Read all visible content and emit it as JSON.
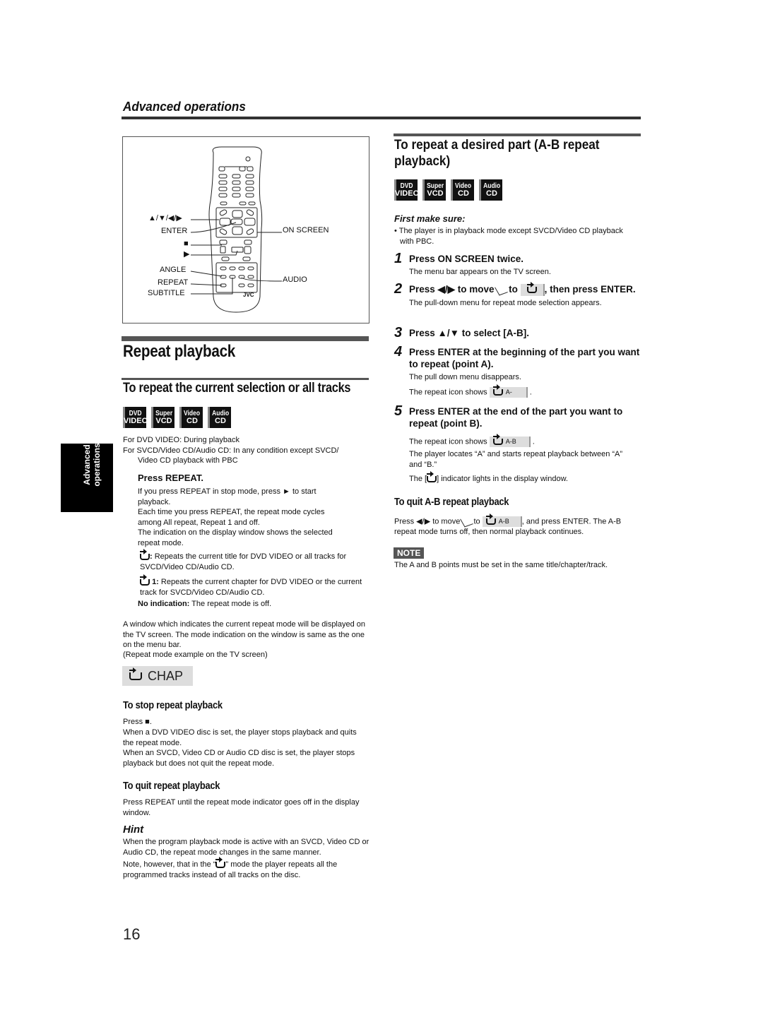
{
  "header": {
    "section_title": "Advanced operations"
  },
  "side_tab": {
    "line1": "Advanced",
    "line2": "operations"
  },
  "remote": {
    "brand": "JVC",
    "labels_left": {
      "arrows": "▲/▼/◀/▶",
      "enter": "ENTER",
      "stop": "■",
      "play": "▶",
      "angle": "ANGLE",
      "repeat": "REPEAT",
      "subtitle": "SUBTITLE"
    },
    "labels_right": {
      "on_screen": "ON SCREEN",
      "audio": "AUDIO"
    }
  },
  "disc_badges": [
    {
      "top": "DVD",
      "bottom": "VIDEO"
    },
    {
      "top": "Super",
      "bottom": "VCD"
    },
    {
      "top": "Video",
      "bottom": "CD"
    },
    {
      "top": "Audio",
      "bottom": "CD"
    }
  ],
  "left": {
    "title": "Repeat playback",
    "subtitle": "To repeat the current selection or all tracks",
    "cond1": "For DVD VIDEO: During playback",
    "cond2": "For SVCD/Video CD/Audio CD: In any condition except SVCD/",
    "cond2b": "Video CD playback with PBC",
    "press_repeat": "Press REPEAT.",
    "p1": "If you press REPEAT in stop mode, press ► to start playback.",
    "p2": "Each time you press REPEAT, the repeat mode cycles among All repeat, Repeat 1 and off.",
    "p3": "The indication on the display window shows the selected repeat mode.",
    "mode_all_suffix": ":",
    "mode_all_desc": " Repeats the current title for DVD VIDEO or all tracks for SVCD/Video CD/Audio CD.",
    "mode_one_suffix": "1:",
    "mode_one_desc": " Repeats the current chapter for DVD VIDEO or the current track for SVCD/Video CD/Audio CD.",
    "no_ind_label": "No indication:",
    "no_ind_desc": " The repeat mode is off.",
    "window_p": "A window which indicates the current repeat mode will be displayed on the TV screen. The mode indication on the window is same as the one on the menu bar.",
    "window_example": "(Repeat mode example on the TV screen)",
    "chap_label": "CHAP",
    "stop_title": "To stop repeat playback",
    "stop_p1": "Press ■.",
    "stop_p2": "When a DVD VIDEO disc is set, the player stops playback and quits the repeat mode.",
    "stop_p3": "When an SVCD, Video CD or Audio CD disc is set, the player stops playback but does not quit the repeat mode.",
    "quit_title": "To quit repeat playback",
    "quit_p": "Press REPEAT until the repeat mode indicator goes off in the display window.",
    "hint_title": "Hint",
    "hint_p1": "When the program playback mode is active with an SVCD, Video CD or Audio CD, the repeat mode changes in the same manner.",
    "hint_p2a": "Note, however, that in the “",
    "hint_p2b": "” mode the player repeats all the programmed tracks instead of all tracks on the disc."
  },
  "right": {
    "title": "To repeat a desired part (A-B repeat playback)",
    "first_make_sure": "First make sure:",
    "fms_item": "The player is in playback mode except SVCD/Video CD playback with PBC.",
    "steps": [
      {
        "num": "1",
        "head": "Press ON SCREEN twice.",
        "desc": "The menu bar appears on the TV screen."
      },
      {
        "num": "2",
        "head_a": "Press ◀/▶ to move",
        "head_b": "to",
        "head_c": ", then press ENTER.",
        "desc": "The pull-down menu for repeat mode selection appears."
      },
      {
        "num": "3",
        "head": "Press ▲/▼ to select [A-B]."
      },
      {
        "num": "4",
        "head": "Press ENTER at the beginning of the part you want to repeat (point A).",
        "desc": "The pull down menu disappears.",
        "desc2": "The repeat icon shows",
        "chip": "A-"
      },
      {
        "num": "5",
        "head": "Press ENTER at the end of the part you want to repeat (point B).",
        "desc2": "The repeat icon shows",
        "chip": "A-B",
        "desc3": "The player locates “A” and starts repeat playback between “A” and “B.”",
        "desc4a": "The [",
        "desc4b": "] indicator lights in the display window."
      }
    ],
    "quit_ab_title": "To quit A-B repeat playback",
    "quit_ab_a": "Press ◀/▶ to move",
    "quit_ab_b": "to",
    "quit_ab_chip": "A-B",
    "quit_ab_c": ", and press ENTER. The A-B repeat mode turns off, then normal playback continues.",
    "note_label": "NOTE",
    "note_text": "The A and B points must be set in the same title/chapter/track."
  },
  "page_number": "16"
}
